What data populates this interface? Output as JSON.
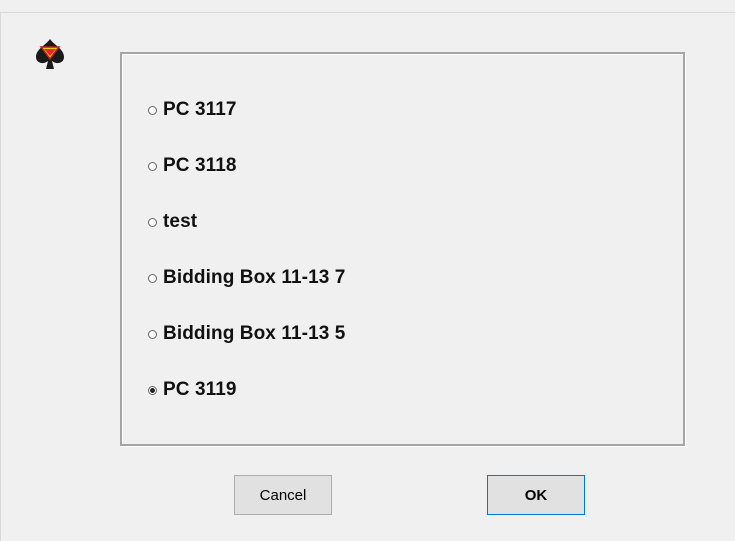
{
  "dialog": {
    "app_icon": "spade-diamond-logo-icon",
    "options": [
      {
        "label": "PC 3117",
        "selected": false
      },
      {
        "label": "PC 3118",
        "selected": false
      },
      {
        "label": "test",
        "selected": false
      },
      {
        "label": "Bidding Box 11-13 7",
        "selected": false
      },
      {
        "label": "Bidding Box 11-13 5",
        "selected": false
      },
      {
        "label": "PC 3119",
        "selected": true
      }
    ],
    "cancel_label": "Cancel",
    "ok_label": "OK"
  },
  "colors": {
    "background": "#f0f0f0",
    "ok_border": "#0078d7",
    "button_face": "#e1e1e1"
  }
}
